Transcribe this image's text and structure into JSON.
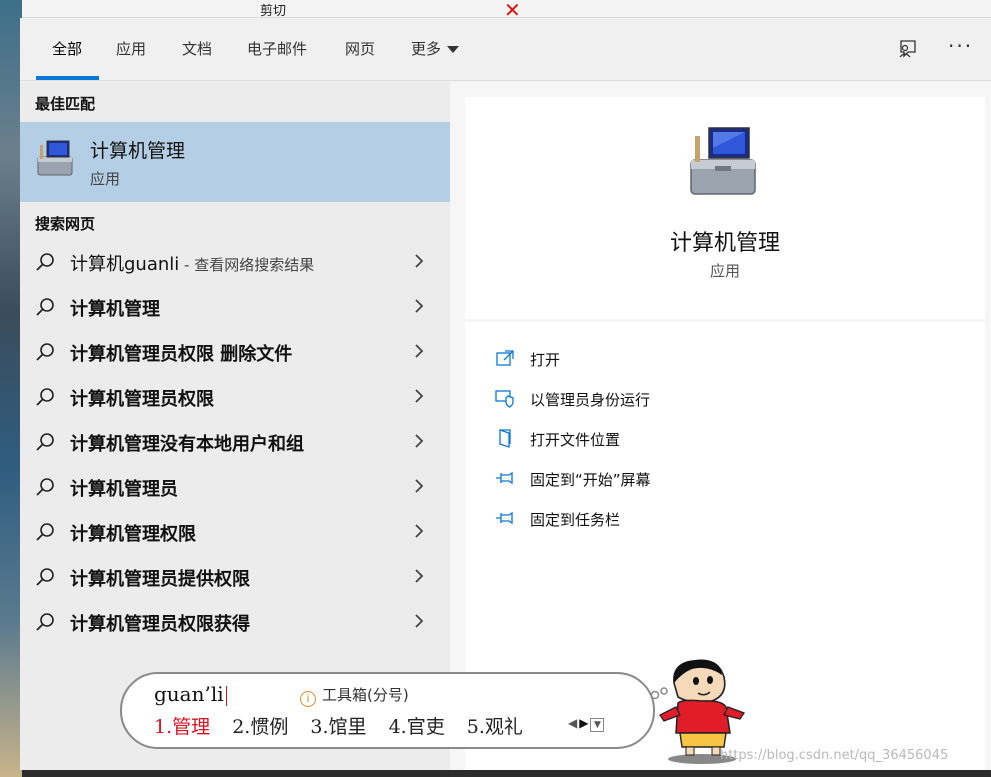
{
  "tabs": [
    {
      "label": "全部",
      "active": true
    },
    {
      "label": "应用",
      "active": false
    },
    {
      "label": "文档",
      "active": false
    },
    {
      "label": "电子邮件",
      "active": false
    },
    {
      "label": "网页",
      "active": false
    },
    {
      "label": "更多",
      "active": false
    }
  ],
  "header_icons": {
    "feedback": "feedback-icon",
    "more": "more-options-icon"
  },
  "best_match": {
    "heading": "最佳匹配",
    "name": "计算机管理",
    "kind": "应用",
    "icon": "computer-management-icon"
  },
  "web_search": {
    "heading": "搜索网页",
    "first": {
      "text": "计算机guanli",
      "suffix": " - 查看网络搜索结果"
    },
    "items": [
      "计算机管理",
      "计算机管理员权限 删除文件",
      "计算机管理员权限",
      "计算机管理没有本地用户和组",
      "计算机管理员",
      "计算机管理权限",
      "计算机管理员提供权限",
      "计算机管理员权限获得"
    ]
  },
  "detail": {
    "name": "计算机管理",
    "kind": "应用",
    "actions": [
      {
        "label": "打开",
        "icon": "open-icon"
      },
      {
        "label": "以管理员身份运行",
        "icon": "run-as-admin-icon"
      },
      {
        "label": "打开文件位置",
        "icon": "file-location-icon"
      },
      {
        "label": "固定到“开始”屏幕",
        "icon": "pin-icon"
      },
      {
        "label": "固定到任务栏",
        "icon": "pin-icon"
      }
    ]
  },
  "ime": {
    "composition": "guan’li",
    "toolbox_label": "工具箱(分号)",
    "candidates": [
      "1.管理",
      "2.惯例",
      "3.馆里",
      "4.官吏",
      "5.观礼"
    ]
  },
  "background": {
    "cut_label": "剪切"
  },
  "watermark": "https://blog.csdn.net/qq_36456045",
  "colors": {
    "accent": "#0a78d7",
    "selected_bg": "#b4cfe5",
    "ime_selected": "#d12"
  }
}
